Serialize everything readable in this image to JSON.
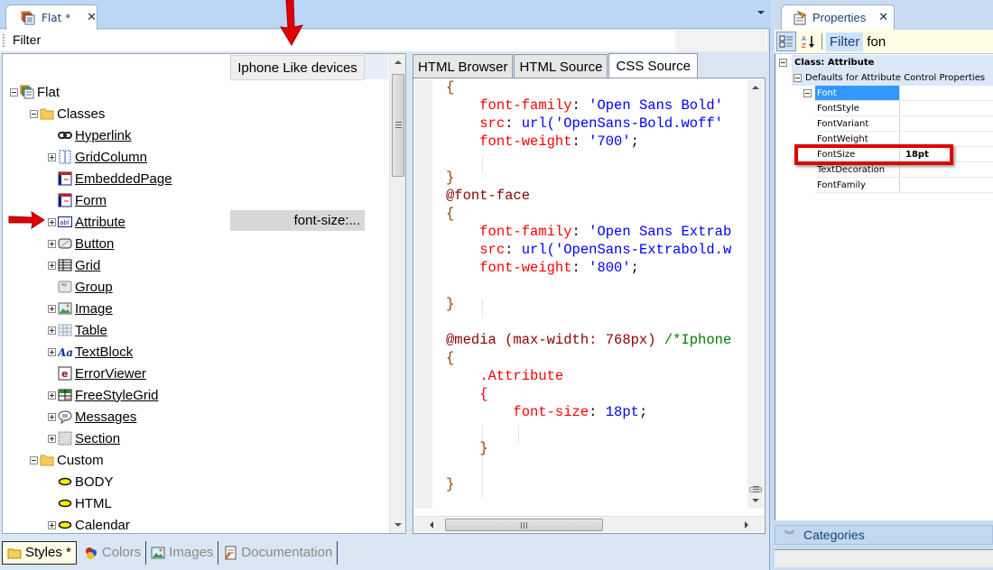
{
  "document": {
    "tab_title": "Flat *",
    "filter_label": "Filter",
    "device_column_header": "Iphone Like devices",
    "tree": [
      {
        "label": "Flat",
        "level": 0,
        "expander": "minus",
        "icon": "theme-icon",
        "link": false
      },
      {
        "label": "Classes",
        "level": 1,
        "expander": "minus",
        "icon": "folder-icon",
        "link": false
      },
      {
        "label": "Hyperlink",
        "level": 2,
        "expander": "none",
        "icon": "hyperlink-icon",
        "link": true
      },
      {
        "label": "GridColumn",
        "level": 2,
        "expander": "plus",
        "icon": "grid-column-icon",
        "link": true
      },
      {
        "label": "EmbeddedPage",
        "level": 2,
        "expander": "none",
        "icon": "embedded-page-icon",
        "link": true
      },
      {
        "label": "Form",
        "level": 2,
        "expander": "none",
        "icon": "form-icon",
        "link": true
      },
      {
        "label": "Attribute",
        "level": 2,
        "expander": "plus",
        "icon": "attribute-icon",
        "link": true
      },
      {
        "label": "Button",
        "level": 2,
        "expander": "plus",
        "icon": "button-icon",
        "link": true
      },
      {
        "label": "Grid",
        "level": 2,
        "expander": "plus",
        "icon": "grid-icon",
        "link": true
      },
      {
        "label": "Group",
        "level": 2,
        "expander": "none",
        "icon": "group-icon",
        "link": true
      },
      {
        "label": "Image",
        "level": 2,
        "expander": "plus",
        "icon": "image-icon",
        "link": true
      },
      {
        "label": "Table",
        "level": 2,
        "expander": "plus",
        "icon": "table-icon",
        "link": true
      },
      {
        "label": "TextBlock",
        "level": 2,
        "expander": "plus",
        "icon": "textblock-icon",
        "link": true
      },
      {
        "label": "ErrorViewer",
        "level": 2,
        "expander": "none",
        "icon": "error-viewer-icon",
        "link": true
      },
      {
        "label": "FreeStyleGrid",
        "level": 2,
        "expander": "plus",
        "icon": "freestyle-grid-icon",
        "link": true
      },
      {
        "label": "Messages",
        "level": 2,
        "expander": "plus",
        "icon": "messages-icon",
        "link": true
      },
      {
        "label": "Section",
        "level": 2,
        "expander": "plus",
        "icon": "section-icon",
        "link": true
      },
      {
        "label": "Custom",
        "level": 1,
        "expander": "minus",
        "icon": "folder-icon",
        "link": false
      },
      {
        "label": "BODY",
        "level": 2,
        "expander": "none",
        "icon": "custom-class-icon",
        "link": false
      },
      {
        "label": "HTML",
        "level": 2,
        "expander": "none",
        "icon": "custom-class-icon",
        "link": false
      },
      {
        "label": "Calendar",
        "level": 2,
        "expander": "plus",
        "icon": "custom-class-icon",
        "link": false
      }
    ],
    "attribute_override_value": "font-size:...",
    "code_tabs": [
      {
        "label": "HTML Browser",
        "active": false
      },
      {
        "label": "HTML Source",
        "active": false
      },
      {
        "label": "CSS Source",
        "active": true
      }
    ],
    "css_source_lines": [
      [
        {
          "t": "{",
          "c": "brace"
        }
      ],
      [
        {
          "t": "    ",
          "c": "punc"
        },
        {
          "t": "font-family",
          "c": "prop"
        },
        {
          "t": ": ",
          "c": "punc"
        },
        {
          "t": "'Open Sans Bold'",
          "c": "val"
        }
      ],
      [
        {
          "t": "    ",
          "c": "punc"
        },
        {
          "t": "src",
          "c": "prop"
        },
        {
          "t": ": ",
          "c": "punc"
        },
        {
          "t": "url('OpenSans-Bold.woff'",
          "c": "val"
        }
      ],
      [
        {
          "t": "    ",
          "c": "punc"
        },
        {
          "t": "font-weight",
          "c": "prop"
        },
        {
          "t": ": ",
          "c": "punc"
        },
        {
          "t": "'700'",
          "c": "val"
        },
        {
          "t": ";",
          "c": "punc"
        }
      ],
      [],
      [
        {
          "t": "}",
          "c": "brace"
        }
      ],
      [
        {
          "t": "@font-face",
          "c": "at"
        }
      ],
      [
        {
          "t": "{",
          "c": "brace"
        }
      ],
      [
        {
          "t": "    ",
          "c": "punc"
        },
        {
          "t": "font-family",
          "c": "prop"
        },
        {
          "t": ": ",
          "c": "punc"
        },
        {
          "t": "'Open Sans Extrab",
          "c": "val"
        }
      ],
      [
        {
          "t": "    ",
          "c": "punc"
        },
        {
          "t": "src",
          "c": "prop"
        },
        {
          "t": ": ",
          "c": "punc"
        },
        {
          "t": "url('OpenSans-Extrabold.w",
          "c": "val"
        }
      ],
      [
        {
          "t": "    ",
          "c": "punc"
        },
        {
          "t": "font-weight",
          "c": "prop"
        },
        {
          "t": ": ",
          "c": "punc"
        },
        {
          "t": "'800'",
          "c": "val"
        },
        {
          "t": ";",
          "c": "punc"
        }
      ],
      [],
      [
        {
          "t": "}",
          "c": "brace"
        }
      ],
      [],
      [
        {
          "t": "@media (max-width: 768px) ",
          "c": "at"
        },
        {
          "t": "/*Iphone",
          "c": "comment"
        }
      ],
      [
        {
          "t": "{",
          "c": "brace"
        }
      ],
      [
        {
          "t": "    ",
          "c": "punc"
        },
        {
          "t": ".Attribute",
          "c": "prop"
        }
      ],
      [
        {
          "t": "    ",
          "c": "punc"
        },
        {
          "t": "{",
          "c": "prop"
        }
      ],
      [
        {
          "t": "        ",
          "c": "punc"
        },
        {
          "t": "font-size",
          "c": "prop"
        },
        {
          "t": ": ",
          "c": "punc"
        },
        {
          "t": "18pt",
          "c": "val"
        },
        {
          "t": ";",
          "c": "punc"
        }
      ],
      [],
      [
        {
          "t": "    ",
          "c": "punc"
        },
        {
          "t": "}",
          "c": "brace"
        }
      ],
      [],
      [
        {
          "t": "}",
          "c": "brace"
        }
      ]
    ],
    "bottom_tabs": [
      {
        "label": "Styles *",
        "icon": "folder-icon",
        "active": true
      },
      {
        "label": "Colors",
        "icon": "colors-icon",
        "active": false
      },
      {
        "label": "Images",
        "icon": "images-icon",
        "active": false
      },
      {
        "label": "Documentation",
        "icon": "documentation-icon",
        "active": false
      }
    ]
  },
  "properties": {
    "tab_title": "Properties",
    "filter_label": "Filter",
    "filter_value": "fon",
    "category": "Class: Attribute",
    "subcategory": "Defaults for Attribute Control Properties",
    "group": "Font",
    "rows": [
      {
        "name": "FontStyle",
        "value": ""
      },
      {
        "name": "FontVariant",
        "value": ""
      },
      {
        "name": "FontWeight",
        "value": ""
      },
      {
        "name": "FontSize",
        "value": "18pt"
      },
      {
        "name": "TextDecoration",
        "value": ""
      },
      {
        "name": "FontFamily",
        "value": ""
      }
    ],
    "categories_label": "Categories"
  },
  "colors": {
    "accent_selection": "#3399ff",
    "annotation_red": "#e00000",
    "css_property": "#ff0000",
    "css_value": "#0000ff",
    "css_comment": "#008000"
  }
}
